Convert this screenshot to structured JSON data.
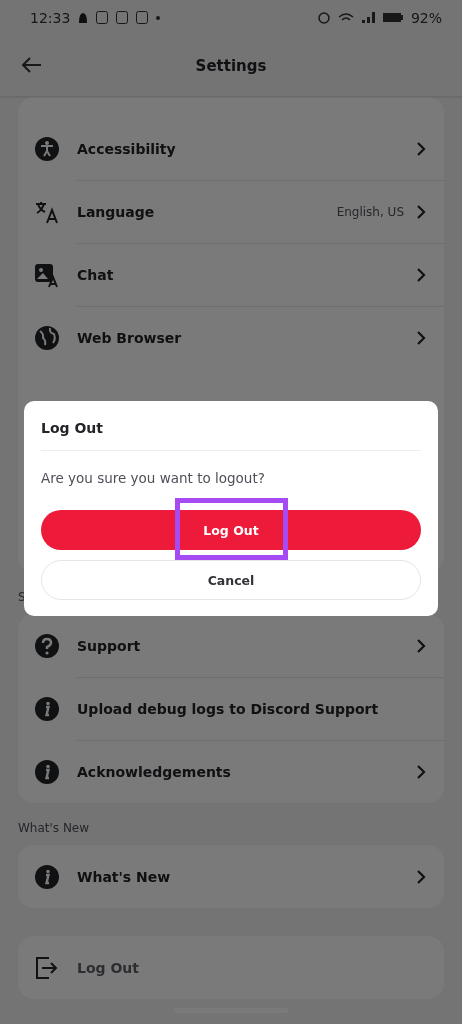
{
  "status_bar": {
    "time": "12:33",
    "battery": "92%"
  },
  "header": {
    "title": "Settings"
  },
  "sections": [
    {
      "items": [
        {
          "label": "Accessibility",
          "kind": "link"
        },
        {
          "label": "Language",
          "value": "English, US",
          "kind": "link"
        },
        {
          "label": "Chat",
          "kind": "link"
        },
        {
          "label": "Web Browser",
          "kind": "link"
        }
      ]
    },
    {
      "title": "S",
      "items": [
        {
          "label": "Support",
          "kind": "link"
        },
        {
          "label": "Upload debug logs to Discord Support",
          "kind": "action"
        },
        {
          "label": "Acknowledgements",
          "kind": "link"
        }
      ]
    },
    {
      "title": "What's New",
      "items": [
        {
          "label": "What's New",
          "kind": "link"
        }
      ]
    },
    {
      "items": [
        {
          "label": "Log Out",
          "kind": "logout"
        }
      ]
    }
  ],
  "dialog": {
    "title": "Log Out",
    "message": "Are you sure you want to logout?",
    "buttons": [
      {
        "label": "Log Out",
        "kind": "primary",
        "highlighted": true
      },
      {
        "label": "Cancel",
        "kind": "secondary",
        "highlighted": false
      }
    ]
  }
}
